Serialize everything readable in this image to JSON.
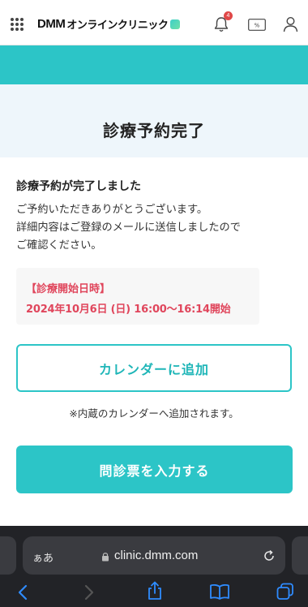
{
  "header": {
    "logo_brand": "DMM",
    "logo_suffix": "オンラインクリニック",
    "notification_count": "4"
  },
  "main": {
    "page_title": "診療予約完了",
    "subhead": "診療予約が完了しました",
    "body_lines": [
      "ご予約いただきありがとうございます。",
      "詳細内容はご登録のメールに送信しましたので",
      "ご確認ください。"
    ],
    "appointment": {
      "label": "【診療開始日時】",
      "datetime": "2024年10月6日 (日) 16:00〜16:14開始"
    },
    "calendar_button": "カレンダーに追加",
    "calendar_note": "※内蔵のカレンダーへ追加されます。",
    "questionnaire_button": "問診票を入力する"
  },
  "browser": {
    "text_size_label": "ぁあ",
    "url": "clinic.dmm.com"
  },
  "colors": {
    "accent": "#2cc5c7",
    "alert": "#e0465c",
    "badge": "#e04848"
  },
  "icons": [
    "grid-menu-icon",
    "bell-icon",
    "coupon-icon",
    "user-icon",
    "lock-icon",
    "reload-icon",
    "back-icon",
    "forward-icon",
    "share-icon",
    "bookmarks-icon",
    "tabs-icon"
  ]
}
